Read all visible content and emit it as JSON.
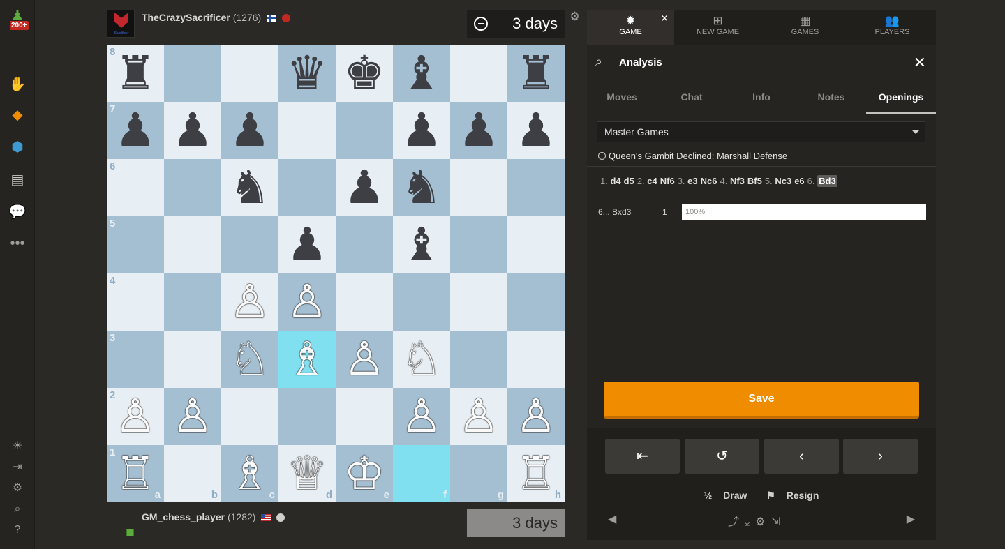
{
  "nav": {
    "badge": "200+",
    "icons": [
      "pawn-icon",
      "puzzle-icon",
      "learn-icon",
      "watch-icon",
      "news-icon",
      "chat-icon",
      "more-icon"
    ],
    "bottom_icons": [
      "theme-icon",
      "collapse-icon",
      "settings-icon",
      "search-icon",
      "help-icon"
    ]
  },
  "top_player": {
    "name": "TheCrazySacrificer",
    "rating": "(1276)",
    "avatar_text": "Sacrificer"
  },
  "bottom_player": {
    "name": "GM_chess_player",
    "rating": "(1282)"
  },
  "clocks": {
    "top": "3 days",
    "bottom": "3 days"
  },
  "board": {
    "ranks": [
      "8",
      "7",
      "6",
      "5",
      "4",
      "3",
      "2",
      "1"
    ],
    "files": [
      "a",
      "b",
      "c",
      "d",
      "e",
      "f",
      "g",
      "h"
    ],
    "position": [
      [
        "♜",
        "",
        "",
        "♛",
        "♚",
        "♝",
        "",
        "♜"
      ],
      [
        "♟",
        "♟",
        "♟",
        "",
        "",
        "♟",
        "♟",
        "♟"
      ],
      [
        "",
        "",
        "♞",
        "",
        "♟",
        "♞",
        "",
        ""
      ],
      [
        "",
        "",
        "",
        "♟",
        "",
        "♝",
        "",
        ""
      ],
      [
        "",
        "",
        "♙",
        "♙",
        "",
        "",
        "",
        ""
      ],
      [
        "",
        "",
        "♘",
        "♗",
        "♙",
        "♘",
        "",
        ""
      ],
      [
        "♙",
        "♙",
        "",
        "",
        "",
        "♙",
        "♙",
        "♙"
      ],
      [
        "♖",
        "",
        "♗",
        "♕",
        "♔",
        "",
        "",
        "♖"
      ]
    ],
    "highlights": [
      "d3",
      "f1"
    ],
    "colors": {
      "light": "#e8eff4",
      "dark": "#a5bfd2",
      "highlight": "#81e0f0"
    }
  },
  "panel": {
    "tabs": [
      {
        "label": "GAME",
        "icon": "sun-icon"
      },
      {
        "label": "NEW GAME",
        "icon": "plus-icon"
      },
      {
        "label": "GAMES",
        "icon": "board-icon"
      },
      {
        "label": "PLAYERS",
        "icon": "players-icon"
      }
    ],
    "analysis_title": "Analysis",
    "subtabs": [
      "Moves",
      "Chat",
      "Info",
      "Notes",
      "Openings"
    ],
    "active_subtab": "Openings",
    "database": "Master Games",
    "opening": "Queen's Gambit Declined: Marshall Defense",
    "moves": [
      {
        "n": "1.",
        "w": "d4",
        "b": "d5"
      },
      {
        "n": "2.",
        "w": "c4",
        "b": "Nf6"
      },
      {
        "n": "3.",
        "w": "e3",
        "b": "Nc6"
      },
      {
        "n": "4.",
        "w": "Nf3",
        "b": "Bf5"
      },
      {
        "n": "5.",
        "w": "Nc3",
        "b": "e6"
      },
      {
        "n": "6.",
        "w": "Bd3",
        "b": ""
      }
    ],
    "stat": {
      "move": "6... Bxd3",
      "count": "1",
      "percent": "100%",
      "fill": 1.0
    },
    "save_label": "Save",
    "draw_label": "Draw",
    "draw_prefix": "½",
    "resign_label": "Resign",
    "accent": "#f08c00"
  }
}
